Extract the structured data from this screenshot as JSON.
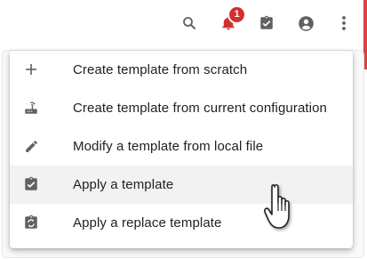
{
  "toolbar": {
    "icons": [
      "search-icon",
      "notifications-icon",
      "assignment-check-icon",
      "account-icon",
      "more-vert-icon"
    ],
    "notification_count": "1",
    "badge_color": "#d32f2f",
    "accent_color": "#d9453f"
  },
  "menu": {
    "items": [
      {
        "label": "Create template from scratch",
        "icon": "add-icon"
      },
      {
        "label": "Create template from current configuration",
        "icon": "router-icon"
      },
      {
        "label": "Modify a template from local file",
        "icon": "edit-icon"
      },
      {
        "label": "Apply a template",
        "icon": "assignment-turned-in-icon",
        "hovered": true
      },
      {
        "label": "Apply a replace template",
        "icon": "assignment-replace-icon"
      }
    ]
  }
}
